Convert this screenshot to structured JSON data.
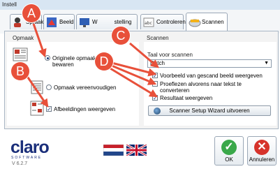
{
  "window": {
    "title": "Instell"
  },
  "tabs": [
    {
      "label": "Spraak",
      "icon": "speaker-icon"
    },
    {
      "label": "Beeld",
      "icon": "image-icon"
    },
    {
      "label": "Weergave-instelling",
      "icon": "monitor-icon"
    },
    {
      "label": "Controleren",
      "icon": "abc-icon"
    },
    {
      "label": "Scannen",
      "icon": "scanner-icon"
    }
  ],
  "tab_partial": {
    "left": "W",
    "right": "stelling"
  },
  "left": {
    "header": "Opmaak",
    "option1_line1": "Originele opmaak",
    "option1_line2": "bewaren",
    "option2": "Opmaak vereenvoudigen",
    "option3": "Afbeeldingen weergeven"
  },
  "right": {
    "header": "Scannen",
    "lang_label": "Taal voor scannen",
    "lang_value": "Dutch",
    "check1": "Voorbeeld van gescand beeld weergeven",
    "check2_line1": "Proeflezen alvorens naar tekst te",
    "check2_line2": "converteren",
    "check3": "Resultaat weergeven",
    "wizard": "Scanner Setup Wizard uitvoeren"
  },
  "markers": [
    "A",
    "B",
    "C",
    "D"
  ],
  "footer": {
    "logo": "claro",
    "logo_sub": "SOFTWARE",
    "version": "V 6.2.7",
    "ok": "OK",
    "cancel": "Annuleren"
  },
  "colors": {
    "marker": "#e8503a",
    "ok": "#3aa84a",
    "cancel": "#d6332b",
    "logo": "#1b2f7a"
  }
}
